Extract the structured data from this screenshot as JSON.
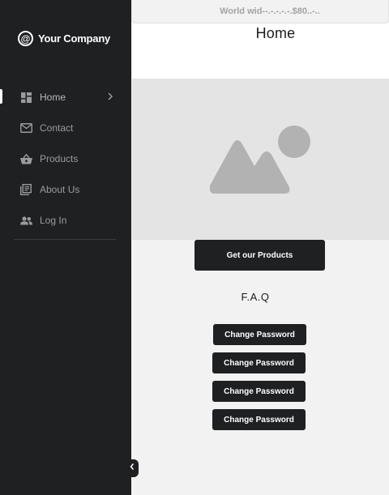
{
  "banner": {
    "text": "World wid--.-.-.-.-.$80..-.."
  },
  "brand": {
    "at_symbol": "@",
    "name": "Your Company"
  },
  "sidebar": {
    "items": [
      {
        "label": "Home",
        "icon": "dashboard-icon",
        "active": true
      },
      {
        "label": "Contact",
        "icon": "mail-icon"
      },
      {
        "label": "Products",
        "icon": "basket-icon"
      },
      {
        "label": "About Us",
        "icon": "library-icon"
      },
      {
        "label": "Log In",
        "icon": "users-icon"
      }
    ],
    "collapse_icon": "chevron-left-icon"
  },
  "main": {
    "title": "Home",
    "hero_icon": "image-placeholder-icon",
    "cta_label": "Get our Products",
    "faq_title": "F.A.Q",
    "faq_buttons": [
      {
        "label": "Change Password"
      },
      {
        "label": "Change Password"
      },
      {
        "label": "Change Password"
      },
      {
        "label": "Change Password"
      }
    ]
  },
  "colors": {
    "sidebar_bg": "#1f2022",
    "button_bg": "#1f2022",
    "page_bg": "#f2f2f3",
    "hero_bg": "#e4e4e4",
    "placeholder": "#b2b2b2"
  }
}
